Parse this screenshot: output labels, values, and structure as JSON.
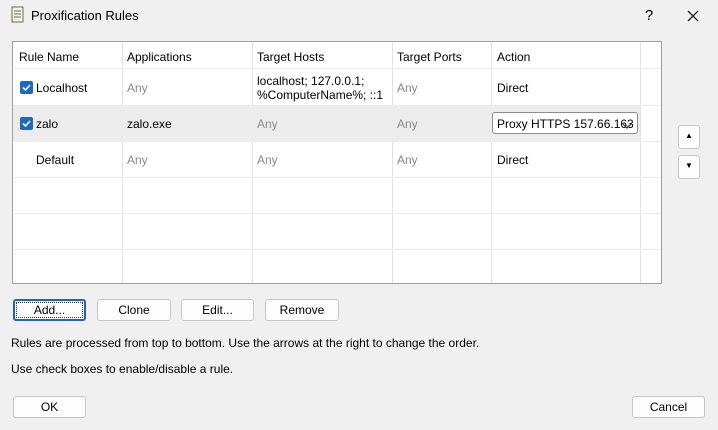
{
  "window": {
    "title": "Proxification Rules",
    "help_label": "?"
  },
  "grid": {
    "columns": [
      "Rule Name",
      "Applications",
      "Target Hosts",
      "Target Ports",
      "Action"
    ],
    "rows": [
      {
        "checked": true,
        "name": "Localhost",
        "applications": "Any",
        "hosts_line1": "localhost; 127.0.0.1;",
        "hosts_line2": "%ComputerName%; ::1",
        "ports": "Any",
        "action": "Direct"
      },
      {
        "checked": true,
        "name": "zalo",
        "applications": "zalo.exe",
        "hosts": "Any",
        "ports": "Any",
        "action": "Proxy HTTPS 157.66.163"
      },
      {
        "checked": false,
        "name": "Default",
        "applications": "Any",
        "hosts": "Any",
        "ports": "Any",
        "action": "Direct"
      }
    ]
  },
  "order_buttons": {
    "up": "▲",
    "down": "▼"
  },
  "buttons": {
    "add": "Add...",
    "clone": "Clone",
    "edit": "Edit...",
    "remove": "Remove",
    "ok": "OK",
    "cancel": "Cancel"
  },
  "info": {
    "line1": "Rules are processed from top to bottom. Use the arrows at the right to change the order.",
    "line2": "Use check boxes to enable/disable a rule."
  },
  "colors": {
    "checkbox": "#1b6ac9",
    "default_button_border": "#1e63c4",
    "muted_text": "#8a8a8a"
  },
  "icons": {
    "title": "document-icon",
    "close": "close-icon",
    "dropdown": "chevron-down-icon",
    "check": "checkmark-icon"
  }
}
